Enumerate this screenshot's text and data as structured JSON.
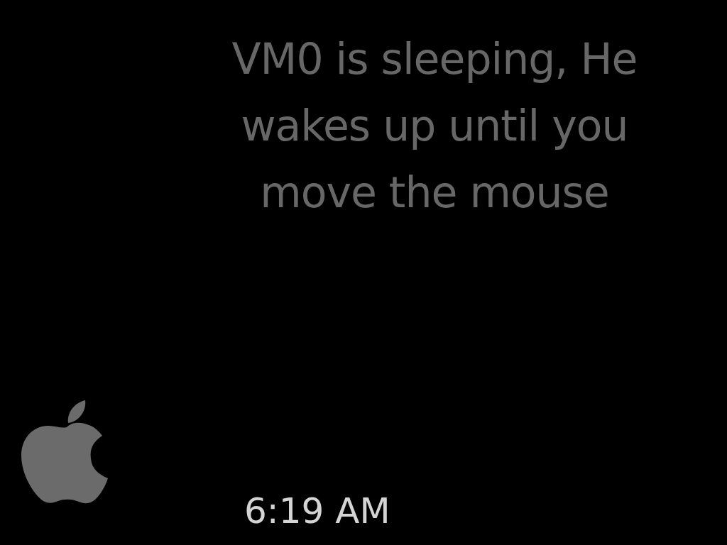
{
  "message": "VM0 is sleeping, He wakes up until you move the mouse",
  "clock": {
    "time": "6:19 AM"
  }
}
